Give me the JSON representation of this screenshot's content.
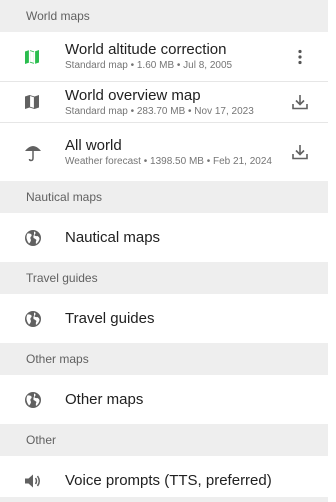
{
  "colors": {
    "accent_green": "#2bbd4f",
    "icon_gray": "#616161",
    "header_bg": "#eeeeee"
  },
  "sections": [
    {
      "header": "World maps",
      "items": [
        {
          "title": "World altitude correction",
          "subtitle": "Standard map • 1.60 MB • Jul 8, 2005",
          "icon": "map-icon-green",
          "action": "more-icon"
        },
        {
          "title": "World overview map",
          "subtitle": "Standard map • 283.70 MB • Nov 17, 2023",
          "icon": "map-icon",
          "action": "download-icon"
        },
        {
          "title": "All world",
          "subtitle": "Weather forecast • 1398.50 MB • Feb 21, 2024",
          "icon": "umbrella-icon",
          "action": "download-icon"
        }
      ]
    },
    {
      "header": "Nautical maps",
      "items": [
        {
          "title": "Nautical maps",
          "icon": "globe-icon"
        }
      ]
    },
    {
      "header": "Travel guides",
      "items": [
        {
          "title": "Travel guides",
          "icon": "globe-icon"
        }
      ]
    },
    {
      "header": "Other maps",
      "items": [
        {
          "title": "Other maps",
          "icon": "globe-icon"
        }
      ]
    },
    {
      "header": "Other",
      "items": [
        {
          "title": "Voice prompts (TTS, preferred)",
          "icon": "speaker-icon"
        }
      ]
    }
  ]
}
